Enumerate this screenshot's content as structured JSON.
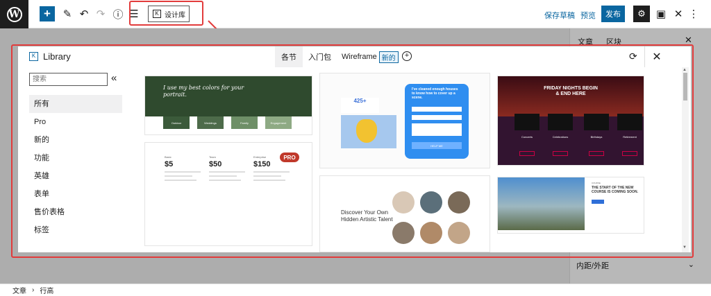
{
  "toolbar": {
    "library_button_label": "设计库",
    "save_draft_label": "保存草稿",
    "preview_label": "预览",
    "publish_label": "发布"
  },
  "sidebar": {
    "tab_post": "文章",
    "tab_block": "区块",
    "padding_label": "内距/外距"
  },
  "breadcrumb": {
    "post": "文章",
    "separator": "›",
    "block": "行高"
  },
  "library": {
    "title": "Library",
    "tabs": [
      {
        "label": "各节"
      },
      {
        "label": "入门包"
      },
      {
        "label": "Wireframe",
        "badge": "新的"
      }
    ],
    "search_placeholder": "搜索",
    "categories": [
      {
        "label": "所有",
        "active": true
      },
      {
        "label": "Pro"
      },
      {
        "label": "新的"
      },
      {
        "label": "功能"
      },
      {
        "label": "英雄"
      },
      {
        "label": "表单"
      },
      {
        "label": "售价表格"
      },
      {
        "label": "标签"
      }
    ]
  },
  "cards": {
    "portrait_title": "I use my best colors for your portrait.",
    "portrait_boxes": [
      "Outdoor",
      "Weddings",
      "Family",
      "Engagement"
    ],
    "pricing_plans": [
      {
        "name": "Basic",
        "price": "$5"
      },
      {
        "name": "Team",
        "price": "$50"
      },
      {
        "name": "Enterprise",
        "price": "$150"
      }
    ],
    "pro_badge": "PRO",
    "form_stat": "425+",
    "form_question": "I've cleaned enough houses to know how to cover up a scene.",
    "form_button": "HELP ME",
    "artistic_title": "Discover Your Own Hidden Artistic Talent",
    "friday_title": "FRIDAY NIGHTS BEGIN & END HERE",
    "friday_labels": [
      "Concerts",
      "Celebrations",
      "Birthdays",
      "Retirement"
    ],
    "course_date": "COURSE",
    "course_title": "THE START OF THE NEW COURSE IS COMING SOON."
  },
  "colors": {
    "accent": "#0a66a0",
    "highlight": "#e23b3b",
    "pro_badge": "#c0392b"
  }
}
